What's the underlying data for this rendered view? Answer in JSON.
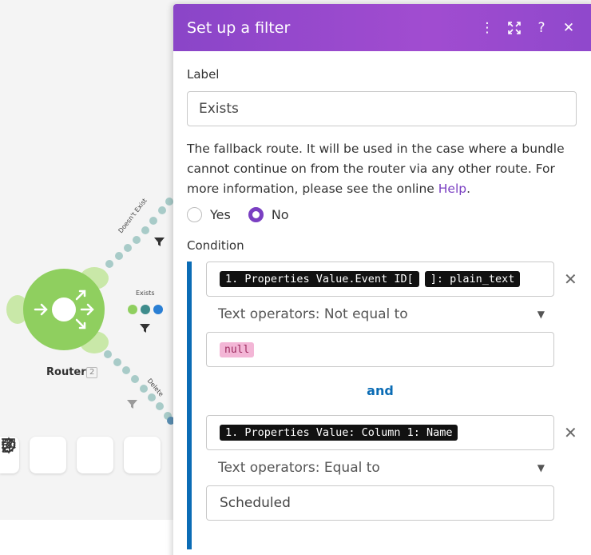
{
  "canvas": {
    "router": {
      "name": "Router",
      "count": "2"
    },
    "routes": [
      {
        "label": "Doesn't Exist"
      },
      {
        "label": "Exists"
      },
      {
        "label": "Delete"
      }
    ],
    "toolbar": [
      {
        "icon": "flow-control-icon"
      },
      {
        "icon": "gear-icon"
      },
      {
        "icon": "note-icon"
      },
      {
        "icon": "magic-wand-icon"
      }
    ],
    "colors": {
      "router": "#8fcf5f",
      "route_dots": "#a8cbc8",
      "active_dot": "#2a7fd4"
    }
  },
  "dialog": {
    "title": "Set up a filter",
    "header_icons": [
      "more-vertical-icon",
      "fullscreen-icon",
      "help-icon",
      "close-icon"
    ],
    "label_field": {
      "label": "Label",
      "value": "Exists"
    },
    "fallback": {
      "text": "The fallback route. It will be used in the case where a bundle cannot continue on from the router via any other route. For more information, please see the online",
      "link": "Help",
      "period": ".",
      "options": [
        {
          "label": "Yes",
          "checked": false
        },
        {
          "label": "No",
          "checked": true
        }
      ]
    },
    "condition": {
      "label": "Condition",
      "rules": [
        {
          "pills": [
            "1. Properties Value.Event ID[",
            "]: plain_text"
          ],
          "operator": "Text operators: Not equal to",
          "value_pill": "null",
          "value": ""
        },
        {
          "pills": [
            "1. Properties Value: Column 1: Name"
          ],
          "operator": "Text operators: Equal to",
          "value_pill": "",
          "value": "Scheduled"
        }
      ],
      "joiner": "and"
    },
    "colors": {
      "header": "#9a4acd",
      "accent": "#7a3fc2",
      "condition_bar": "#0b6cb5"
    }
  }
}
